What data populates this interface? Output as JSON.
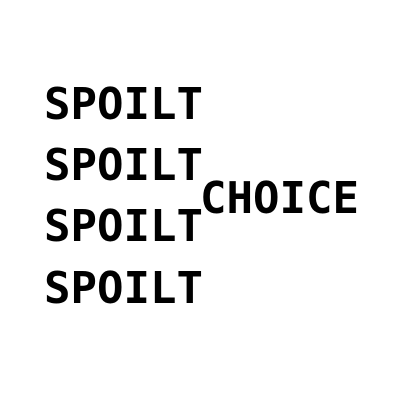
{
  "words": [
    "SPOILT",
    "SPOILT",
    "SPOILT",
    "SPOILT"
  ],
  "highlight_word": "CHOICE",
  "colors": {
    "text": "#000000",
    "background": "#ffffff"
  }
}
